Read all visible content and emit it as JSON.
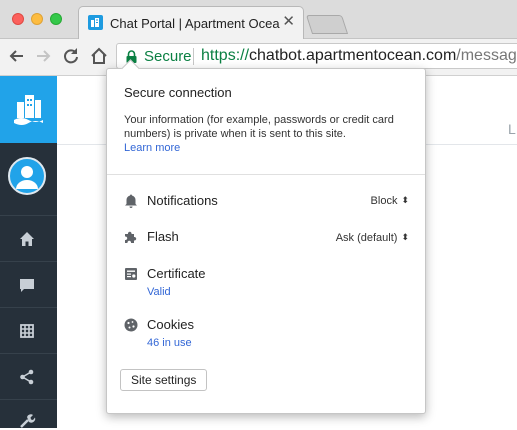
{
  "browser": {
    "tab": {
      "title": "Chat Portal | Apartment Ocean",
      "close_glyph": "✕",
      "favicon": "apartment-ocean-logo-icon"
    },
    "security_label": "Secure",
    "url": {
      "scheme": "https://",
      "host": "chatbot.apartmentocean.com",
      "path": "/messages/"
    },
    "colors": {
      "secure_green": "#0b8043",
      "link_blue": "#3367d6"
    }
  },
  "site_info": {
    "title": "Secure connection",
    "description": "Your information (for example, passwords or credit card numbers) is private when it is sent to this site.",
    "learn_more": "Learn more",
    "rows": {
      "notifications": {
        "label": "Notifications",
        "value": "Block",
        "icon": "bell-icon"
      },
      "flash": {
        "label": "Flash",
        "value": "Ask (default)",
        "icon": "puzzle-icon"
      },
      "certificate": {
        "label": "Certificate",
        "sub": "Valid",
        "icon": "certificate-icon"
      },
      "cookies": {
        "label": "Cookies",
        "sub": "46 in use",
        "icon": "cookie-icon"
      }
    },
    "site_settings_label": "Site settings"
  },
  "page": {
    "header_fragment": "L",
    "sidebar": {
      "brand_color": "#21a3e9",
      "background": "#26303a",
      "icons": [
        "home-icon",
        "chat-icon",
        "grid-icon",
        "share-icon",
        "wrench-icon"
      ]
    }
  }
}
